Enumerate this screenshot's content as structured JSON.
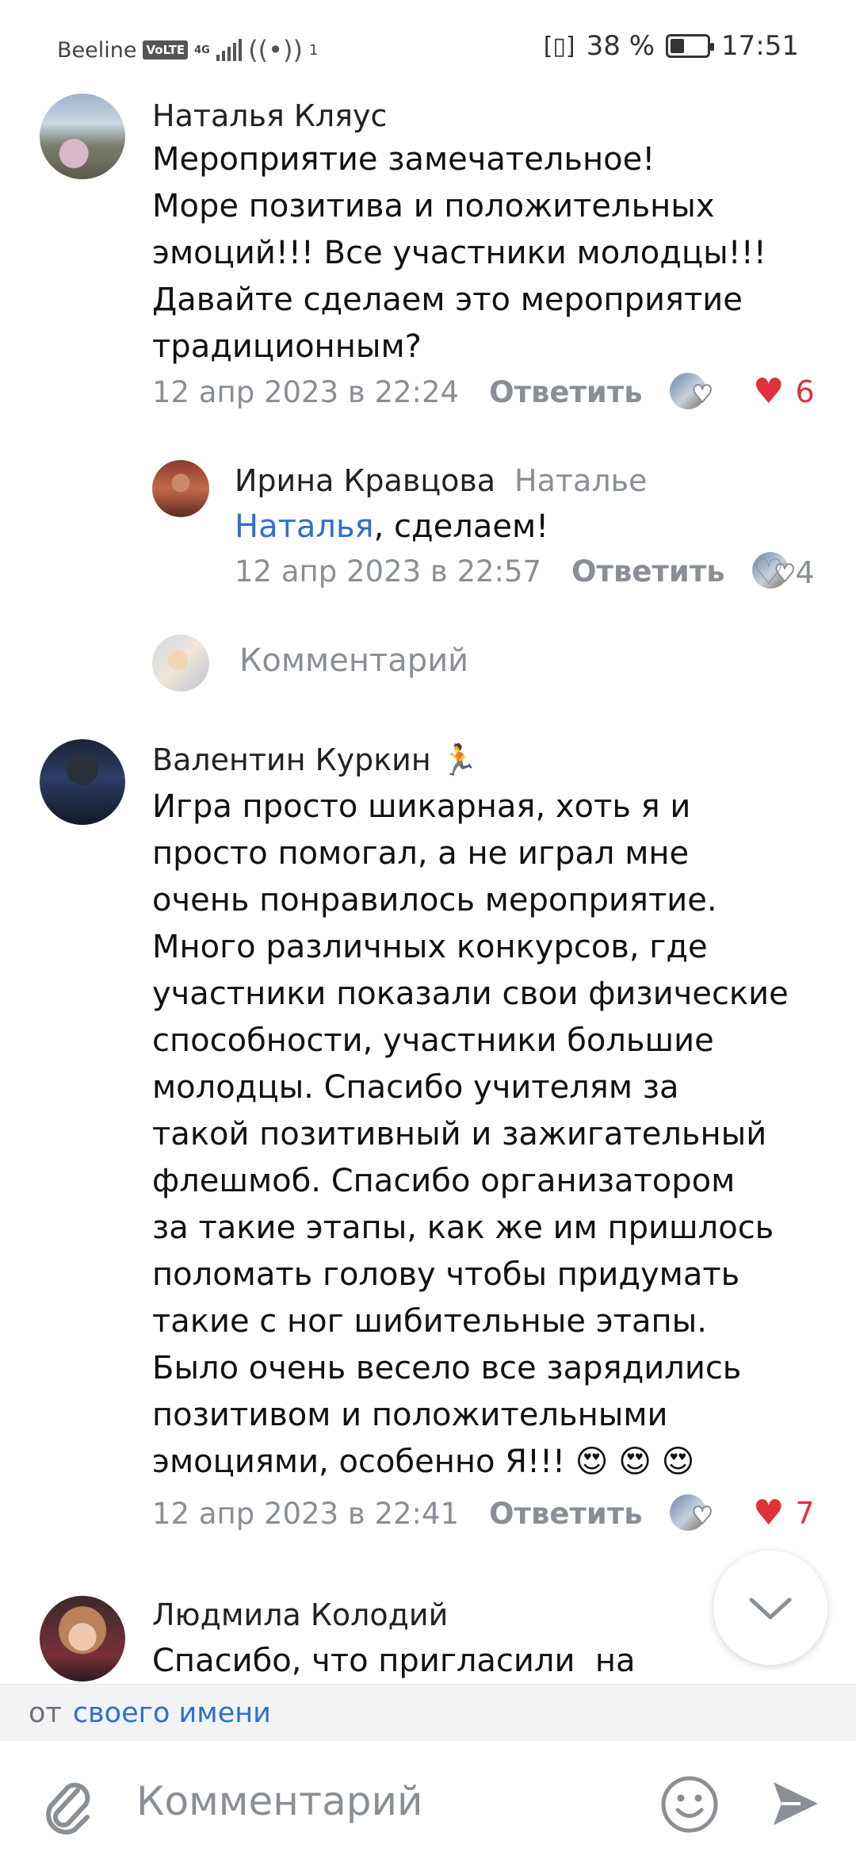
{
  "status_bar": {
    "carrier": "Beeline",
    "volte": "VoLTE",
    "network": "4G",
    "hotspot_count": "1",
    "battery": "38 %",
    "battery_level": 0.38,
    "time": "17:51"
  },
  "comments": [
    {
      "author": "Наталья Кляус",
      "lines": [
        "Мероприятие замечательное!",
        "Море позитива и положительных",
        "эмоций!!! Все участники молодцы!!!",
        "Давайте сделаем это мероприятие",
        "традиционным?"
      ],
      "date": "12 апр 2023 в 22:24",
      "reply_label": "Ответить",
      "likes": "6",
      "liked": true
    },
    {
      "author": "Ирина Кравцова",
      "reply_to": "Наталье",
      "mention": "Наталья",
      "text_after_mention": ", сделаем!",
      "date": "12 апр 2023 в 22:57",
      "reply_label": "Ответить",
      "likes": "4",
      "liked": false
    },
    {
      "author": "Валентин Куркин",
      "author_emoji": "🏃",
      "lines": [
        "Игра просто шикарная, хоть я и",
        "просто помогал, а не играл мне",
        "очень понравилось мероприятие.",
        "Много различных конкурсов, где",
        "участники показали свои физические",
        "способности, участники большие",
        "молодцы. Спасибо учителям за",
        "такой позитивный и зажигательный",
        "флешмоб. Спасибо организатором",
        "за такие этапы, как же им пришлось",
        "поломать голову чтобы придумать",
        "такие с ног шибительные этапы.",
        "Было очень весело все зарядились",
        "позитивом и положительными",
        "эмоциями, особенно Я!!! 😍 😍 😍"
      ],
      "date": "12 апр 2023 в 22:41",
      "reply_label": "Ответить",
      "likes": "7",
      "liked": true
    },
    {
      "author": "Людмила Колодий",
      "lines": [
        "Спасибо, что пригласили  на"
      ]
    }
  ],
  "thread_comment_prompt": "Комментарий",
  "reply_from": {
    "prefix": "от",
    "link": "своего имени"
  },
  "composer": {
    "placeholder": "Комментарий"
  },
  "icons": {
    "attach": "paperclip-icon",
    "emoji": "smile-icon",
    "send": "send-icon",
    "scroll_down": "chevron-down-icon",
    "like": "heart-icon"
  },
  "colors": {
    "link": "#2e6fcf",
    "like_active": "#e0303c",
    "secondary_text": "#8a8f96"
  }
}
